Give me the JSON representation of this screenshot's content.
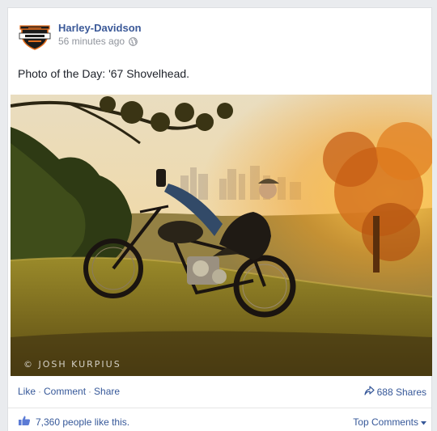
{
  "post": {
    "page_name": "Harley-Davidson",
    "timestamp": "56 minutes ago",
    "caption": "Photo of the Day: '67 Shovelhead.",
    "photo_credit": "© JOSH KURPIUS",
    "avatar_icon": "harley-davidson-logo-icon",
    "privacy_icon": "globe-icon"
  },
  "actions": {
    "like_label": "Like",
    "comment_label": "Comment",
    "share_label": "Share",
    "separator": "·",
    "shares_count": "688 Shares",
    "share_icon": "share-arrow-icon"
  },
  "likes": {
    "like_icon": "thumbs-up-icon",
    "text": "7,360 people like this.",
    "top_comments_label": "Top Comments",
    "dropdown_icon": "caret-down-icon"
  },
  "colors": {
    "link_blue": "#3b5998",
    "action_blue": "#365899",
    "muted_gray": "#90949c",
    "background": "#e9ebee"
  }
}
